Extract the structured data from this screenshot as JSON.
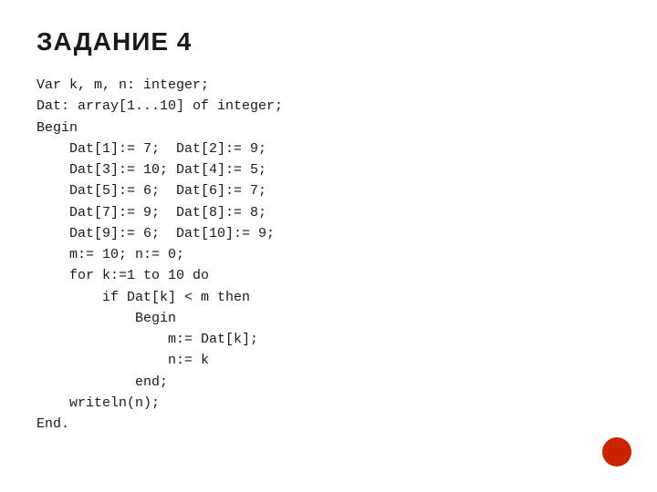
{
  "title": "ЗАДАНИЕ 4",
  "code": "Var k, m, n: integer;\nDat: array[1...10] of integer;\nBegin\n    Dat[1]:= 7;  Dat[2]:= 9;\n    Dat[3]:= 10; Dat[4]:= 5;\n    Dat[5]:= 6;  Dat[6]:= 7;\n    Dat[7]:= 9;  Dat[8]:= 8;\n    Dat[9]:= 6;  Dat[10]:= 9;\n    m:= 10; n:= 0;\n    for k:=1 to 10 do\n        if Dat[k] < m then\n            Begin\n                m:= Dat[k];\n                n:= k\n            end;\n    writeln(n);\nEnd."
}
